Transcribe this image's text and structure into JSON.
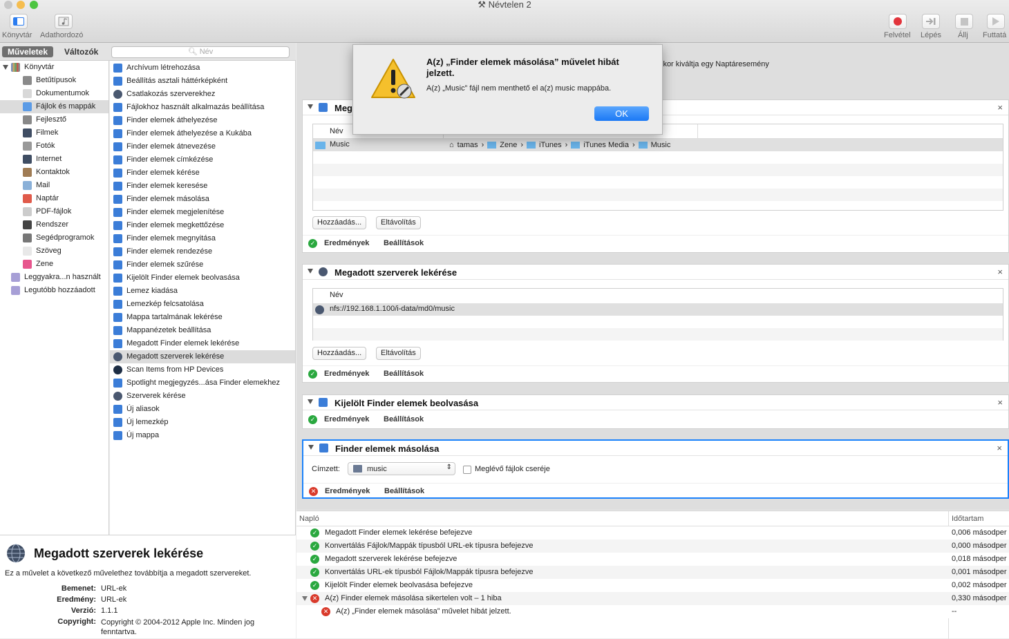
{
  "window": {
    "title": "Névtelen 2"
  },
  "toolbar": {
    "library": "Könyvtár",
    "media": "Adathordozó",
    "record": "Felvétel",
    "step": "Lépés",
    "stop": "Állj",
    "run": "Futtatá"
  },
  "sidebar": {
    "tab_actions": "Műveletek",
    "tab_variables": "Változók",
    "search_placeholder": "Név",
    "library_root": "Könyvtár",
    "library_items": [
      "Betűtípusok",
      "Dokumentumok",
      "Fájlok és mappák",
      "Fejlesztő",
      "Filmek",
      "Fotók",
      "Internet",
      "Kontaktok",
      "Mail",
      "Naptár",
      "PDF-fájlok",
      "Rendszer",
      "Segédprogramok",
      "Szöveg",
      "Zene"
    ],
    "smart_items": [
      "Leggyakra...n használt",
      "Legutóbb hozzáadott"
    ],
    "actions": [
      "Archívum létrehozása",
      "Beállítás asztali háttérképként",
      "Csatlakozás szerverekhez",
      "Fájlokhoz használt alkalmazás beállítása",
      "Finder elemek áthelyezése",
      "Finder elemek áthelyezése a Kukába",
      "Finder elemek átnevezése",
      "Finder elemek címkézése",
      "Finder elemek kérése",
      "Finder elemek keresése",
      "Finder elemek másolása",
      "Finder elemek megjelenítése",
      "Finder elemek megkettőzése",
      "Finder elemek megnyitása",
      "Finder elemek rendezése",
      "Finder elemek szűrése",
      "Kijelölt Finder elemek beolvasása",
      "Lemez kiadása",
      "Lemezkép felcsatolása",
      "Mappa tartalmának lekérése",
      "Mappanézetek beállítása",
      "Megadott Finder elemek lekérése",
      "Megadott szerverek lekérése",
      "Scan Items from HP Devices",
      "Spotlight megjegyzés...ása Finder elemekhez",
      "Szerverek kérése",
      "Új aliasok",
      "Új lemezkép",
      "Új mappa"
    ]
  },
  "description": {
    "title": "Megadott szerverek lekérése",
    "text": "Ez a művelet a következő művelethez továbbítja a megadott szervereket.",
    "input_label": "Bemenet:",
    "input_value": "URL-ek",
    "output_label": "Eredmény:",
    "output_value": "URL-ek",
    "version_label": "Verzió:",
    "version_value": "1.1.1",
    "copyright_label": "Copyright:",
    "copyright_value": "Copyright © 2004-2012 Apple Inc. Minden jog fenntartva."
  },
  "workflow": {
    "header_text": "ikor kiváltja egy Naptáresemény",
    "card1": {
      "title": "Meg",
      "col_name": "Név",
      "item_name": "Music",
      "path": [
        "tamas",
        "Zene",
        "iTunes",
        "iTunes Media",
        "Music"
      ],
      "add": "Hozzáadás...",
      "remove": "Eltávolítás",
      "results": "Eredmények",
      "options": "Beállítások"
    },
    "card2": {
      "title": "Megadott szerverek lekérése",
      "col_name": "Név",
      "item": "nfs://192.168.1.100/i-data/md0/music",
      "add": "Hozzáadás...",
      "remove": "Eltávolítás",
      "results": "Eredmények",
      "options": "Beállítások"
    },
    "card3": {
      "title": "Kijelölt Finder elemek beolvasása",
      "results": "Eredmények",
      "options": "Beállítások"
    },
    "card4": {
      "title": "Finder elemek másolása",
      "to_label": "Címzett:",
      "to_value": "music",
      "replace_label": "Meglévő fájlok cseréje",
      "results": "Eredmények",
      "options": "Beállítások"
    },
    "close": "×"
  },
  "log": {
    "col_log": "Napló",
    "col_duration": "Időtartam",
    "rows": [
      {
        "text": "Megadott Finder elemek lekérése befejezve",
        "dur": "0,006 másodper"
      },
      {
        "text": "Konvertálás Fájlok/Mappák típusból URL-ek típusra befejezve",
        "dur": "0,000 másodper"
      },
      {
        "text": "Megadott szerverek lekérése befejezve",
        "dur": "0,018 másodper"
      },
      {
        "text": "Konvertálás URL-ek típusból Fájlok/Mappák típusra befejezve",
        "dur": "0,001 másodper"
      },
      {
        "text": "Kijelölt Finder elemek beolvasása befejezve",
        "dur": "0,002 másodper"
      },
      {
        "text": "A(z) Finder elemek másolása sikertelen volt – 1 hiba",
        "dur": "0,330 másodper"
      },
      {
        "text": "A(z) „Finder elemek másolása” művelet hibát jelzett.",
        "dur": "--"
      }
    ]
  },
  "dialog": {
    "title": "A(z) „Finder elemek másolása” művelet hibát jelzett.",
    "message": "A(z) „Music” fájl nem menthető el a(z) music mappába.",
    "ok": "OK"
  },
  "colors": {
    "accent": "#1a82fb",
    "success": "#2aa83f",
    "error": "#d93a2b"
  }
}
